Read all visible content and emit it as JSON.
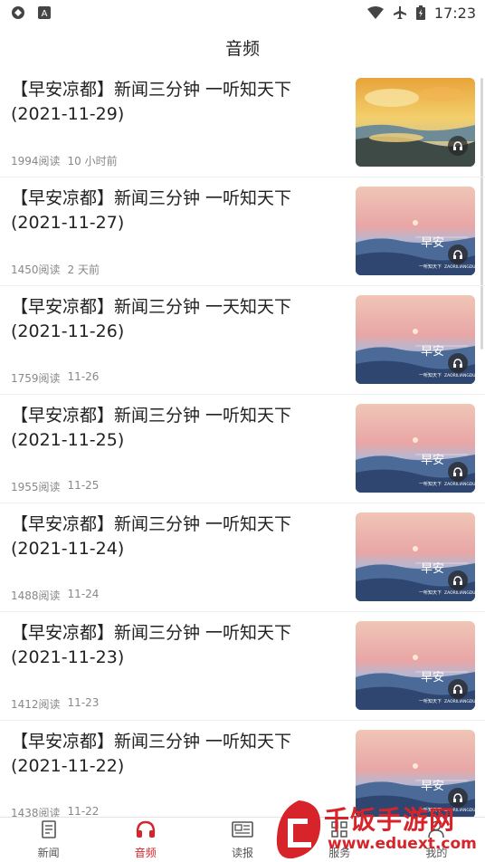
{
  "status": {
    "time": "17:23"
  },
  "header": {
    "title": "音频"
  },
  "items": [
    {
      "title_line1": "【早安凉都】新闻三分钟 一听知天下",
      "title_line2": "(2021-11-29)",
      "reads": "1994阅读",
      "time": "10 小时前",
      "thumb": "sunrise-lake"
    },
    {
      "title_line1": "【早安凉都】新闻三分钟 一听知天下",
      "title_line2": "(2021-11-27)",
      "reads": "1450阅读",
      "time": "2 天前",
      "thumb": "pink-sky"
    },
    {
      "title_line1": "【早安凉都】新闻三分钟 一天知天下",
      "title_line2": "(2021-11-26)",
      "reads": "1759阅读",
      "time": "11-26",
      "thumb": "pink-sky"
    },
    {
      "title_line1": "【早安凉都】新闻三分钟 一听知天下",
      "title_line2": "(2021-11-25)",
      "reads": "1955阅读",
      "time": "11-25",
      "thumb": "pink-sky"
    },
    {
      "title_line1": "【早安凉都】新闻三分钟 一听知天下",
      "title_line2": "(2021-11-24)",
      "reads": "1488阅读",
      "time": "11-24",
      "thumb": "pink-sky"
    },
    {
      "title_line1": "【早安凉都】新闻三分钟 一听知天下",
      "title_line2": "(2021-11-23)",
      "reads": "1412阅读",
      "time": "11-23",
      "thumb": "pink-sky"
    },
    {
      "title_line1": "【早安凉都】新闻三分钟 一听知天下",
      "title_line2": "(2021-11-22)",
      "reads": "1438阅读",
      "time": "11-22",
      "thumb": "pink-sky"
    }
  ],
  "thumb_text": {
    "main": "早安",
    "sub": "一听知天下",
    "brand": "ZAORILIANGDU"
  },
  "tabs": [
    {
      "label": "新闻",
      "icon": "news-icon",
      "active": false
    },
    {
      "label": "音频",
      "icon": "headphones-icon",
      "active": true
    },
    {
      "label": "读报",
      "icon": "newspaper-icon",
      "active": false
    },
    {
      "label": "服务",
      "icon": "grid-icon",
      "active": false
    },
    {
      "label": "我的",
      "icon": "person-icon",
      "active": false
    }
  ],
  "watermark": {
    "text": "千饭手游网",
    "url": "www.eduext.com"
  },
  "colors": {
    "accent": "#d6242a",
    "text": "#222222",
    "meta": "#888888"
  }
}
